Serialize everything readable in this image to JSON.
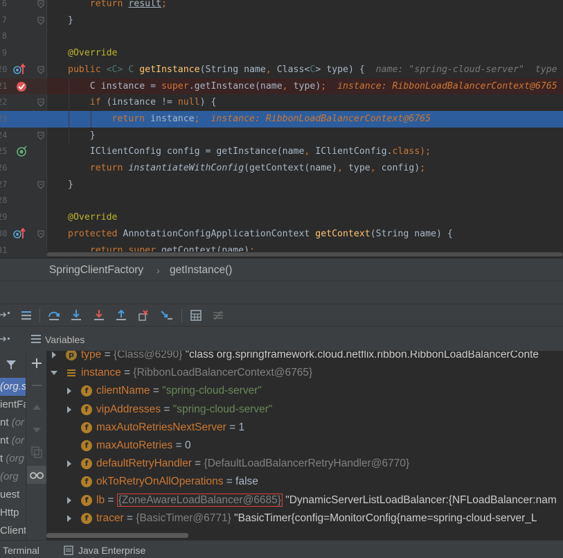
{
  "editor": {
    "lines": [
      {
        "num": "6",
        "parts": [
          {
            "t": "    ",
            "c": ""
          },
          {
            "t": "return ",
            "c": "kw"
          },
          {
            "t": "result",
            "c": "ul"
          },
          {
            "t": ";",
            "c": "kw"
          }
        ]
      },
      {
        "num": "7",
        "parts": [
          {
            "t": "}",
            "c": ""
          }
        ]
      },
      {
        "num": "8",
        "parts": []
      },
      {
        "num": "9",
        "parts": [
          {
            "t": "@Override",
            "c": "ann"
          }
        ]
      },
      {
        "num": "20",
        "parts": [
          {
            "t": "public ",
            "c": "kw"
          },
          {
            "t": "<C> C ",
            "c": "gen"
          },
          {
            "t": "getInstance",
            "c": "fn"
          },
          {
            "t": "(String name",
            "c": ""
          },
          {
            "t": ", ",
            "c": "kw"
          },
          {
            "t": "Class<",
            "c": ""
          },
          {
            "t": "C",
            "c": "gen"
          },
          {
            "t": "> type) {  ",
            "c": ""
          },
          {
            "t": "name: \"spring-cloud-server\"  type",
            "c": "hint"
          }
        ]
      },
      {
        "num": "21",
        "parts": [
          {
            "t": "    C instance = ",
            "c": ""
          },
          {
            "t": "super",
            "c": "kw"
          },
          {
            "t": ".getInstance(name",
            "c": ""
          },
          {
            "t": ", ",
            "c": "kw"
          },
          {
            "t": "type)",
            "c": ""
          },
          {
            "t": ";  ",
            "c": "kw"
          },
          {
            "t": "instance: RibbonLoadBalancerContext@6765",
            "c": "hint-o"
          }
        ]
      },
      {
        "num": "22",
        "parts": [
          {
            "t": "    ",
            "c": ""
          },
          {
            "t": "if ",
            "c": "kw"
          },
          {
            "t": "(instance != ",
            "c": ""
          },
          {
            "t": "null",
            "c": "kw"
          },
          {
            "t": ") {",
            "c": ""
          }
        ]
      },
      {
        "num": "23",
        "parts": [
          {
            "t": "        ",
            "c": ""
          },
          {
            "t": "return ",
            "c": "kw"
          },
          {
            "t": "instance",
            "c": ""
          },
          {
            "t": ";  ",
            "c": "kw"
          },
          {
            "t": "instance: RibbonLoadBalancerContext@6765",
            "c": "hint-o"
          }
        ]
      },
      {
        "num": "24",
        "parts": [
          {
            "t": "    }",
            "c": ""
          }
        ]
      },
      {
        "num": "25",
        "parts": [
          {
            "t": "    IClientConfig config = getInstance(name",
            "c": ""
          },
          {
            "t": ", ",
            "c": "kw"
          },
          {
            "t": "IClientConfig.",
            "c": ""
          },
          {
            "t": "class",
            "c": "kw"
          },
          {
            "t": ");",
            "c": "kw"
          }
        ]
      },
      {
        "num": "26",
        "parts": [
          {
            "t": "    ",
            "c": ""
          },
          {
            "t": "return ",
            "c": "kw"
          },
          {
            "t": "instantiateWithConfig",
            "c": "it"
          },
          {
            "t": "(getContext(name)",
            "c": ""
          },
          {
            "t": ", ",
            "c": "kw"
          },
          {
            "t": "type",
            "c": ""
          },
          {
            "t": ", ",
            "c": "kw"
          },
          {
            "t": "config)",
            "c": ""
          },
          {
            "t": ";",
            "c": "kw"
          }
        ]
      },
      {
        "num": "27",
        "parts": [
          {
            "t": "}",
            "c": ""
          }
        ]
      },
      {
        "num": "28",
        "parts": []
      },
      {
        "num": "29",
        "parts": [
          {
            "t": "@Override",
            "c": "ann"
          }
        ]
      },
      {
        "num": "30",
        "parts": [
          {
            "t": "protected ",
            "c": "kw"
          },
          {
            "t": "AnnotationConfigApplicationContext ",
            "c": ""
          },
          {
            "t": "getContext",
            "c": "fn"
          },
          {
            "t": "(String name) {",
            "c": ""
          }
        ]
      },
      {
        "num": "31",
        "parts": [
          {
            "t": "    ",
            "c": ""
          },
          {
            "t": "return super",
            "c": "kw"
          },
          {
            "t": ".getContext(name)",
            "c": ""
          },
          {
            "t": ";",
            "c": "kw"
          }
        ]
      }
    ]
  },
  "breadcrumb": {
    "class_name": "SpringClientFactory",
    "separator": "›",
    "method_name": "getInstance()"
  },
  "variables_panel": {
    "title": "Variables"
  },
  "frames": [
    {
      "text": "(org.s",
      "selected": true
    },
    {
      "text": "ientFa",
      "selected": false
    },
    {
      "text": "nt ",
      "dim": "(or",
      "selected": false
    },
    {
      "text": "nt ",
      "dim": "(or",
      "selected": false
    },
    {
      "text": "t ",
      "dim": "(org",
      "selected": false
    },
    {
      "text": "",
      "dim": "(org",
      "selected": false
    },
    {
      "text": "uest",
      "selected": false
    },
    {
      "text": "Http",
      "selected": false
    },
    {
      "text": "Client",
      "selected": false
    }
  ],
  "variables": [
    {
      "name": "type",
      "badge": "p",
      "type_ref": "{Class@6290}",
      "desc": "\"class org.springframework.cloud.netflix.ribbon.RibbonLoadBalancerConte",
      "arrow": "right",
      "level": 0
    },
    {
      "name": "instance",
      "badge": "=",
      "type_ref": "{RibbonLoadBalancerContext@6765}",
      "desc": "",
      "arrow": "down",
      "level": 0
    },
    {
      "name": "clientName",
      "badge": "f",
      "str": "\"spring-cloud-server\"",
      "arrow": "right",
      "level": 1
    },
    {
      "name": "vipAddresses",
      "badge": "f",
      "str": "\"spring-cloud-server\"",
      "arrow": "right",
      "level": 1
    },
    {
      "name": "maxAutoRetriesNextServer",
      "badge": "f",
      "val": "1",
      "arrow": "",
      "level": 1
    },
    {
      "name": "maxAutoRetries",
      "badge": "f",
      "val": "0",
      "arrow": "",
      "level": 1
    },
    {
      "name": "defaultRetryHandler",
      "badge": "f",
      "type_ref": "{DefaultLoadBalancerRetryHandler@6770}",
      "arrow": "right",
      "level": 1
    },
    {
      "name": "okToRetryOnAllOperations",
      "badge": "f",
      "val": "false",
      "arrow": "",
      "level": 1
    },
    {
      "name": "lb",
      "badge": "f",
      "type_ref": "{ZoneAwareLoadBalancer@6685}",
      "boxed": true,
      "desc": "\"DynamicServerListLoadBalancer:{NFLoadBalancer:nam",
      "arrow": "right",
      "level": 1
    },
    {
      "name": "tracer",
      "badge": "f",
      "type_ref": "{BasicTimer@6771}",
      "desc": "\"BasicTimer{config=MonitorConfig{name=spring-cloud-server_L",
      "arrow": "right",
      "level": 1
    }
  ],
  "bottom_bar": {
    "terminal": "Terminal",
    "java_enterprise": "Java Enterprise"
  },
  "colors": {
    "keyword": "#cc7832",
    "annotation": "#bbb529",
    "function": "#ffc66d",
    "string": "#6a8759",
    "execution_line": "#2d5d9d",
    "breakpoint_line": "#3a2323",
    "highlight_box": "#e04040"
  }
}
